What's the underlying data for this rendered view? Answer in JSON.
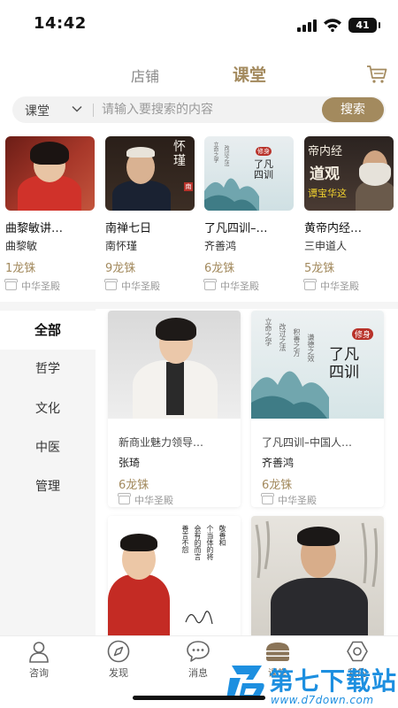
{
  "status": {
    "time": "14:42",
    "battery": "41"
  },
  "header": {
    "tab_shop": "店铺",
    "tab_class": "课堂",
    "cart_icon": "cart-icon"
  },
  "search": {
    "scope": "课堂",
    "placeholder": "请输入要搜索的内容",
    "button": "搜索"
  },
  "featured": [
    {
      "title": "曲黎敏讲…",
      "author": "曲黎敏",
      "price": "1龙铢",
      "shop": "中华圣殿"
    },
    {
      "title": "南禅七日",
      "author": "南怀瑾",
      "price": "9龙铢",
      "shop": "中华圣殿"
    },
    {
      "title": "了凡四训–…",
      "author": "齐善鸿",
      "price": "6龙铢",
      "shop": "中华圣殿"
    },
    {
      "title": "黄帝内经…",
      "author": "三申道人",
      "price": "5龙铢",
      "shop": "中华圣殿"
    }
  ],
  "thumb_text": {
    "c2_calligraphy": "怀瑾",
    "c2_seal": "南",
    "c3_main": "了凡四训",
    "c3_tag": "修身",
    "c3_side": [
      "立命之学",
      "改过之法",
      "积善之方",
      "谦德之效"
    ],
    "c4_top": "帝内经",
    "c4_mid": "道观",
    "c4_bottom": "谭宝华这"
  },
  "sidebar": {
    "items": [
      {
        "label": "全部"
      },
      {
        "label": "哲学"
      },
      {
        "label": "文化"
      },
      {
        "label": "中医"
      },
      {
        "label": "管理"
      }
    ]
  },
  "grid": [
    {
      "title": "新商业魅力领导…",
      "author": "张琦",
      "price": "6龙铢",
      "shop": "中华圣殿"
    },
    {
      "title": "了凡四训–中国人…",
      "author": "齐善鸿",
      "price": "6龙铢",
      "shop": "中华圣殿"
    },
    {
      "title": "",
      "author": "",
      "price": "",
      "shop": ""
    },
    {
      "title": "",
      "author": "",
      "price": "",
      "shop": ""
    }
  ],
  "grid_thumb_text": {
    "g2_main": "了凡四训",
    "g2_tag": "修身",
    "g2_side": [
      "立命之学",
      "改过之法",
      "积善之方",
      "谦德之效"
    ],
    "g3_poem": [
      "善言不怨",
      "会有的而言",
      "个当体的将",
      "敬善和"
    ]
  },
  "bottom_nav": [
    {
      "label": "咨询",
      "icon": "user-icon"
    },
    {
      "label": "发现",
      "icon": "compass-icon"
    },
    {
      "label": "消息",
      "icon": "chat-icon"
    },
    {
      "label": "课堂",
      "icon": "classroom-icon"
    },
    {
      "label": "我的",
      "icon": "settings-icon"
    }
  ],
  "watermark": {
    "name": "第七下载站",
    "url": "www.d7down.com"
  },
  "colors": {
    "accent": "#a38a5e",
    "watermark": "#1d8fe0"
  }
}
